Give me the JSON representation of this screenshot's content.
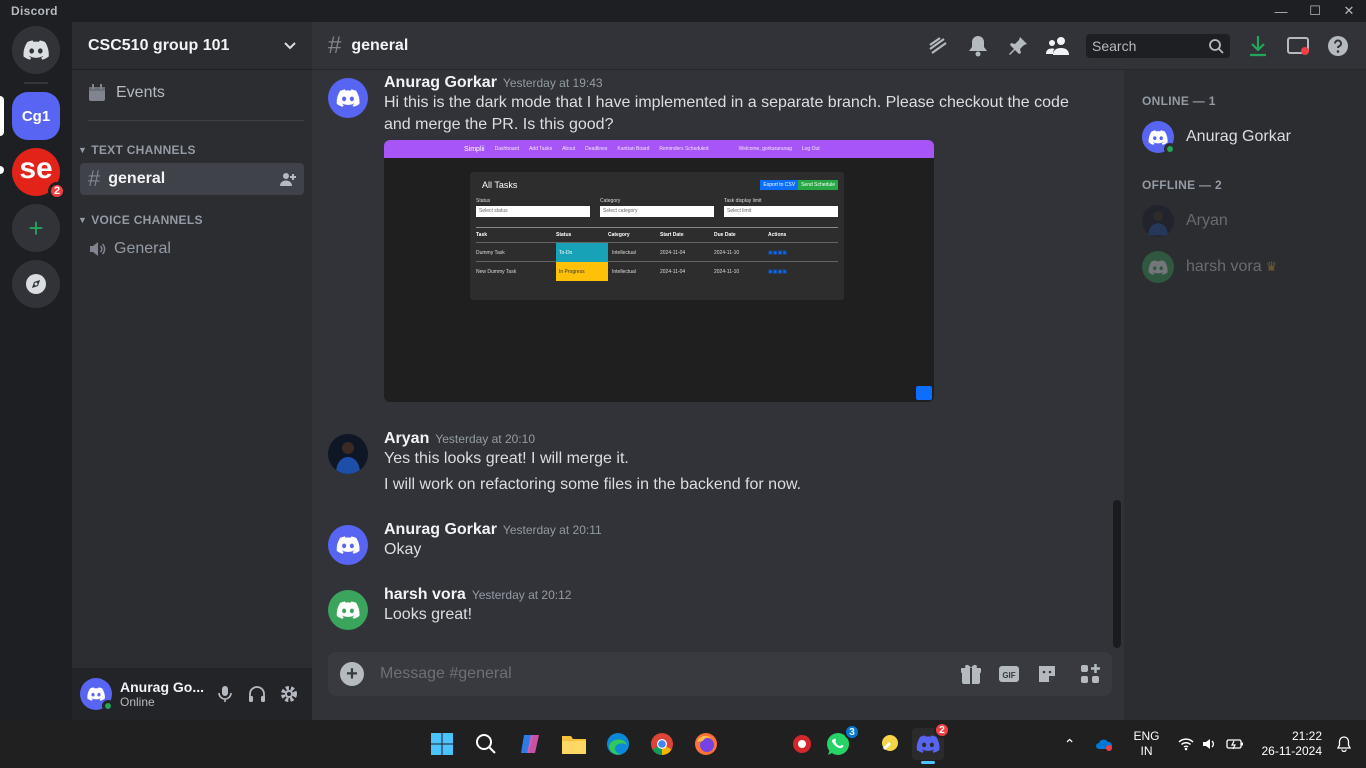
{
  "window": {
    "brand": "Discord",
    "minimize": "—",
    "maximize": "☐",
    "close": "✕"
  },
  "guilds": [
    {
      "label": "Cg1"
    },
    {
      "label": "se",
      "badge": "2"
    }
  ],
  "sidebar": {
    "server_name": "CSC510 group 101",
    "events_label": "Events",
    "text_category": "TEXT CHANNELS",
    "voice_category": "VOICE CHANNELS",
    "text_channel": "general",
    "voice_channel": "General"
  },
  "user_panel": {
    "name": "Anurag Go...",
    "status": "Online"
  },
  "channel_header": {
    "hash": "#",
    "name": "general",
    "search_placeholder": "Search"
  },
  "messages": [
    {
      "author": "Anurag Gorkar",
      "timestamp": "Yesterday at 19:43",
      "lines": [
        "Hi this is the dark mode that I have implemented in a separate branch. Please checkout the code",
        "and merge the PR. Is this good?"
      ]
    },
    {
      "author": "Aryan",
      "timestamp": "Yesterday at 20:10",
      "lines": [
        "Yes this looks great! I will merge it.",
        "I will work on refactoring some files in the backend for now."
      ]
    },
    {
      "author": "Anurag Gorkar",
      "timestamp": "Yesterday at 20:11",
      "lines": [
        "Okay"
      ]
    },
    {
      "author": "harsh vora",
      "timestamp": "Yesterday at 20:12",
      "lines": [
        "Looks great!"
      ]
    }
  ],
  "attachment": {
    "nav_logo": "Simplii",
    "nav_items": [
      "Dashboard",
      "Add Tasks",
      "About",
      "Deadlines",
      "Kanban Board",
      "Reminders Scheduled"
    ],
    "nav_right": [
      "Welcome, gorkaranurag",
      "Log Out"
    ],
    "panel_title": "All Tasks",
    "export_btn": "Export to CSV",
    "send_btn": "Send Schedule",
    "filters": [
      {
        "label": "Status",
        "value": "Select status"
      },
      {
        "label": "Category",
        "value": "Select category"
      },
      {
        "label": "Task display limit",
        "value": "Select limit"
      }
    ],
    "columns": [
      "Task",
      "Status",
      "Category",
      "Start Date",
      "Due Date",
      "Actions"
    ],
    "rows": [
      [
        "Dummy Task",
        "To-Do",
        "Intellectual",
        "2024-11-04",
        "2024-11-10"
      ],
      [
        "New Dummy Task",
        "In Progress",
        "Intellectual",
        "2024-11-04",
        "2024-11-10"
      ]
    ]
  },
  "composer": {
    "placeholder": "Message #general"
  },
  "members": {
    "online_header": "ONLINE — 1",
    "offline_header": "OFFLINE — 2",
    "online": [
      "Anurag Gorkar"
    ],
    "offline": [
      "Aryan",
      "harsh vora"
    ]
  },
  "taskbar": {
    "whatsapp_badge": "3",
    "discord_badge": "2",
    "lang_1": "ENG",
    "lang_2": "IN",
    "time": "21:22",
    "date": "26-11-2024"
  },
  "colors": {
    "blurple": "#5865f2",
    "green": "#23a55a",
    "dark": "#313338"
  }
}
